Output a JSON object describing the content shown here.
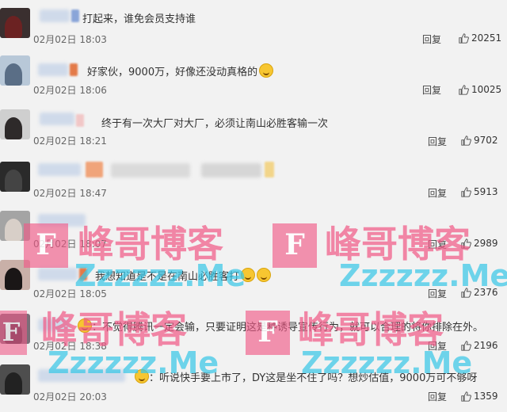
{
  "comments": [
    {
      "text": "打起来，谁免会员支持谁",
      "time": "02月02日 18:03",
      "reply": "回复",
      "likes": "20251"
    },
    {
      "text": "好家伙，9000万，好像还没动真格的",
      "time": "02月02日 18:06",
      "reply": "回复",
      "likes": "10025"
    },
    {
      "text": "终于有一次大厂对大厂，必须让南山必胜客输一次",
      "time": "02月02日 18:21",
      "reply": "回复",
      "likes": "9702"
    },
    {
      "text": "",
      "time": "02月02日 18:47",
      "reply": "回复",
      "likes": "5913"
    },
    {
      "text": "",
      "time": "02月02日 18:07",
      "reply": "回复",
      "likes": "2989"
    },
    {
      "text": "我想知道是不是在南山必胜客打",
      "time": "02月02日 18:05",
      "reply": "回复",
      "likes": "2376"
    },
    {
      "text": "不觉得腾讯一定会输，只要证明这是种诱导宣传行为，就可以合理的将你排除在外。",
      "time": "02月02日 18:38",
      "reply": "回复",
      "likes": "2196"
    },
    {
      "text": "听说快手要上市了，DY这是坐不住了吗？想炒估值，9000万可不够呀",
      "time": "02月02日 20:03",
      "reply": "回复",
      "likes": "1359"
    }
  ],
  "watermark": {
    "title": "峰哥博客",
    "domain": "Zzzzzz.Me",
    "letter": "F"
  },
  "colors": {
    "background": "#f2f2f2",
    "text": "#333333",
    "time": "#666666",
    "watermark_pink": "#f05a87",
    "watermark_cyan": "#39c6e6"
  },
  "icons": {
    "like": "thumbs-up-icon",
    "emoji": "grinning-face-icon"
  }
}
